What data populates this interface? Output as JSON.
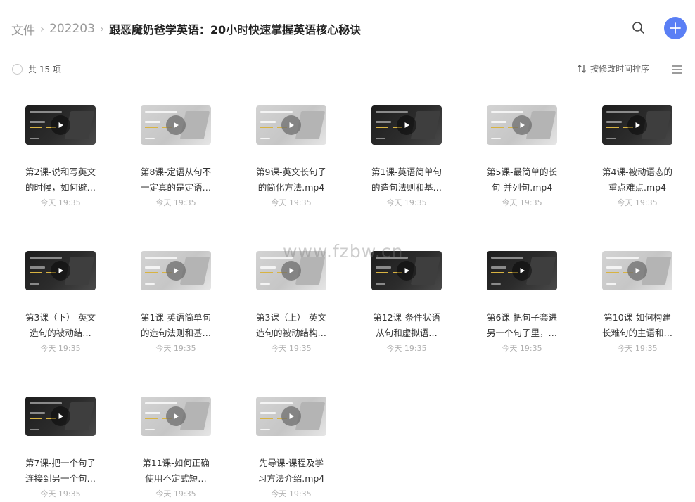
{
  "breadcrumb": {
    "root": "文件",
    "folder": "202203",
    "current": "跟恶魔奶爸学英语：20小时快速掌握英语核心秘诀"
  },
  "toolbar": {
    "count_label": "共 15 项",
    "sort_label": "按修改时间排序"
  },
  "accent_color": "#5a7ff5",
  "icons": {
    "search": "search-icon",
    "add": "plus-icon",
    "sort": "sort-arrows-icon",
    "view": "list-view-icon",
    "play": "play-icon"
  },
  "files": [
    {
      "line1": "第2课-说和写英文",
      "line2": "的时候，如何避…",
      "time": "今天 19:35",
      "thumb": "dark"
    },
    {
      "line1": "第8课-定语从句不",
      "line2": "一定真的是定语…",
      "time": "今天 19:35",
      "thumb": "light"
    },
    {
      "line1": "第9课-英文长句子",
      "line2": "的简化方法.mp4",
      "time": "今天 19:35",
      "thumb": "light"
    },
    {
      "line1": "第1课-英语简单句",
      "line2": "的造句法则和基…",
      "time": "今天 19:35",
      "thumb": "dark"
    },
    {
      "line1": "第5课-最简单的长",
      "line2": "句-并列句.mp4",
      "time": "今天 19:35",
      "thumb": "light"
    },
    {
      "line1": "第4课-被动语态的",
      "line2": "重点难点.mp4",
      "time": "今天 19:35",
      "thumb": "dark"
    },
    {
      "line1": "第3课（下）-英文",
      "line2": "造句的被动结…",
      "time": "今天 19:35",
      "thumb": "dark"
    },
    {
      "line1": "第1课-英语简单句",
      "line2": "的造句法则和基…",
      "time": "今天 19:35",
      "thumb": "light"
    },
    {
      "line1": "第3课（上）-英文",
      "line2": "造句的被动结构…",
      "time": "今天 19:35",
      "thumb": "light"
    },
    {
      "line1": "第12课-条件状语",
      "line2": "从句和虚拟语…",
      "time": "今天 19:35",
      "thumb": "dark"
    },
    {
      "line1": "第6课-把句子套进",
      "line2": "另一个句子里，…",
      "time": "今天 19:35",
      "thumb": "dark"
    },
    {
      "line1": "第10课-如何构建",
      "line2": "长难句的主语和…",
      "time": "今天 19:35",
      "thumb": "light"
    },
    {
      "line1": "第7课-把一个句子",
      "line2": "连接到另一个句…",
      "time": "今天 19:35",
      "thumb": "dark"
    },
    {
      "line1": "第11课-如何正确",
      "line2": "使用不定式短…",
      "time": "今天 19:35",
      "thumb": "light"
    },
    {
      "line1": "先导课-课程及学",
      "line2": "习方法介绍.mp4",
      "time": "今天 19:35",
      "thumb": "light"
    }
  ],
  "watermark": "www.fzbw.cn"
}
